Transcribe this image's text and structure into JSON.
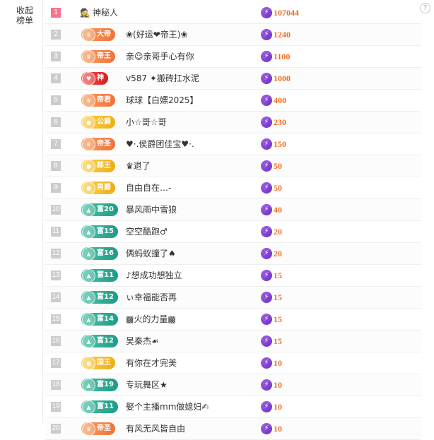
{
  "ui": {
    "collapse_label": "收起榜单",
    "help": "?"
  },
  "colors": {
    "score": "#f06d23",
    "top_rank": "#f5758e",
    "bolt": "#8a44dc"
  },
  "rows": [
    {
      "rank": "1",
      "badge": "",
      "badge_icon": "",
      "color": "",
      "name": "神秘人",
      "anon": true,
      "score": "107044"
    },
    {
      "rank": "2",
      "badge": "大帝",
      "badge_icon": "crown-icon",
      "color": "orange",
      "name": "❀(好运❤帝王)❀",
      "anon": false,
      "score": "1240"
    },
    {
      "rank": "3",
      "badge": "帝王",
      "badge_icon": "crown-icon",
      "color": "orange",
      "name": "亲☺亲哥手心有你",
      "anon": false,
      "score": "1100"
    },
    {
      "rank": "4",
      "badge": "神",
      "badge_icon": "heart-icon",
      "color": "red",
      "name": "v587 ✦搬砖扛水泥",
      "anon": false,
      "score": "1000"
    },
    {
      "rank": "5",
      "badge": "帝君",
      "badge_icon": "crown-icon",
      "color": "orange",
      "name": "球球【白嫖2025】",
      "anon": false,
      "score": "400"
    },
    {
      "rank": "6",
      "badge": "公爵",
      "badge_icon": "medal-icon",
      "color": "gold",
      "name": "小☆哥☆哥",
      "anon": false,
      "score": "230"
    },
    {
      "rank": "7",
      "badge": "帝圣",
      "badge_icon": "crown-icon",
      "color": "orange",
      "name": "♥·.侯爵团佳宝♥·.",
      "anon": false,
      "score": "150"
    },
    {
      "rank": "8",
      "badge": "郡王",
      "badge_icon": "medal-icon",
      "color": "gold",
      "name": "♛退了",
      "anon": false,
      "score": "50"
    },
    {
      "rank": "9",
      "badge": "男爵",
      "badge_icon": "medal-icon",
      "color": "gold",
      "name": "自由自在…-",
      "anon": false,
      "score": "50"
    },
    {
      "rank": "10",
      "badge": "富20",
      "badge_icon": "triangle-icon",
      "color": "teal",
      "name": "暴风雨中雪狼",
      "anon": false,
      "score": "40"
    },
    {
      "rank": "11",
      "badge": "富15",
      "badge_icon": "triangle-icon",
      "color": "teal",
      "name": "空空酷跑♂",
      "anon": false,
      "score": "20"
    },
    {
      "rank": "12",
      "badge": "富16",
      "badge_icon": "triangle-icon",
      "color": "teal",
      "name": "俩蚂蚁撞了♠",
      "anon": false,
      "score": "20"
    },
    {
      "rank": "13",
      "badge": "富11",
      "badge_icon": "triangle-icon",
      "color": "teal",
      "name": "♪想成功想独立",
      "anon": false,
      "score": "15"
    },
    {
      "rank": "14",
      "badge": "富12",
      "badge_icon": "triangle-icon",
      "color": "teal",
      "name": "ぃ幸福能否再",
      "anon": false,
      "score": "15"
    },
    {
      "rank": "15",
      "badge": "富14",
      "badge_icon": "triangle-icon",
      "color": "teal",
      "name": "▩火的力量▩",
      "anon": false,
      "score": "15"
    },
    {
      "rank": "16",
      "badge": "富12",
      "badge_icon": "triangle-icon",
      "color": "teal",
      "name": "吴秦杰☙",
      "anon": false,
      "score": "15"
    },
    {
      "rank": "17",
      "badge": "国王",
      "badge_icon": "medal-icon",
      "color": "gold",
      "name": "有你在才完美",
      "anon": false,
      "score": "10"
    },
    {
      "rank": "18",
      "badge": "富19",
      "badge_icon": "triangle-icon",
      "color": "teal",
      "name": "专玩舞区★",
      "anon": false,
      "score": "10"
    },
    {
      "rank": "19",
      "badge": "富11",
      "badge_icon": "triangle-icon",
      "color": "teal",
      "name": "娶个主播mm做媳妇✍",
      "anon": false,
      "score": "10"
    },
    {
      "rank": "20",
      "badge": "帝圣",
      "badge_icon": "crown-icon",
      "color": "orange",
      "name": "有风无风皆自由",
      "anon": false,
      "score": "10"
    }
  ]
}
